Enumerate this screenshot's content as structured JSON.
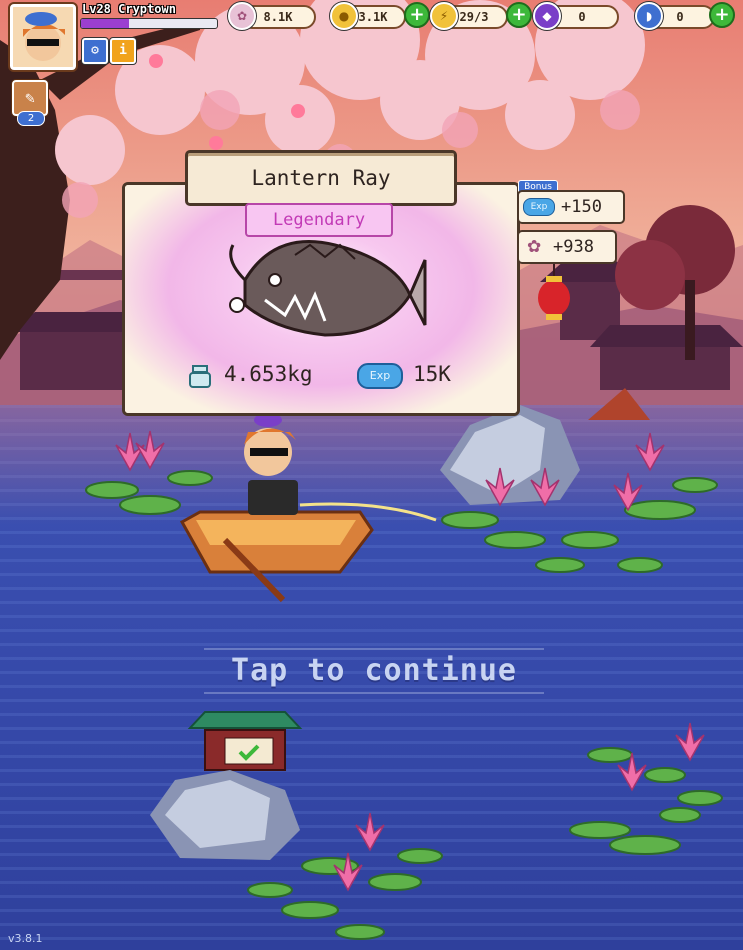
{
  "player": {
    "level_text": "Lv28 Cryptown",
    "xp_fraction": 0.35
  },
  "currencies": {
    "blossoms": "8.1K",
    "coins": "3.1K",
    "energy": "29/3",
    "purple_gem": "0",
    "blue_fish": "0"
  },
  "side_buttons": {
    "collection_count": "2"
  },
  "catch": {
    "fish_name": "Lantern Ray",
    "rarity": "Legendary",
    "weight": "4.653kg",
    "exp_tag": "Exp",
    "exp_value": "15K"
  },
  "bonus": {
    "label": "Bonus",
    "exp_tag": "Exp",
    "exp_bonus": "+150",
    "blossom_bonus": "+938"
  },
  "prompt": "Tap to continue",
  "version": "v3.8.1",
  "colors": {
    "rarity_legendary": "#c23ab6",
    "water": "#3a4fb0",
    "sky": "#ec9a88"
  },
  "icons": {
    "settings": "gear-icon",
    "info": "info-icon",
    "collection": "book-icon",
    "blossom": "flower-icon",
    "coin": "coin-icon",
    "energy": "lightning-icon",
    "gem": "gem-icon",
    "fish": "fish-icon",
    "scale": "scale-icon",
    "shrine_check": "check-icon"
  }
}
